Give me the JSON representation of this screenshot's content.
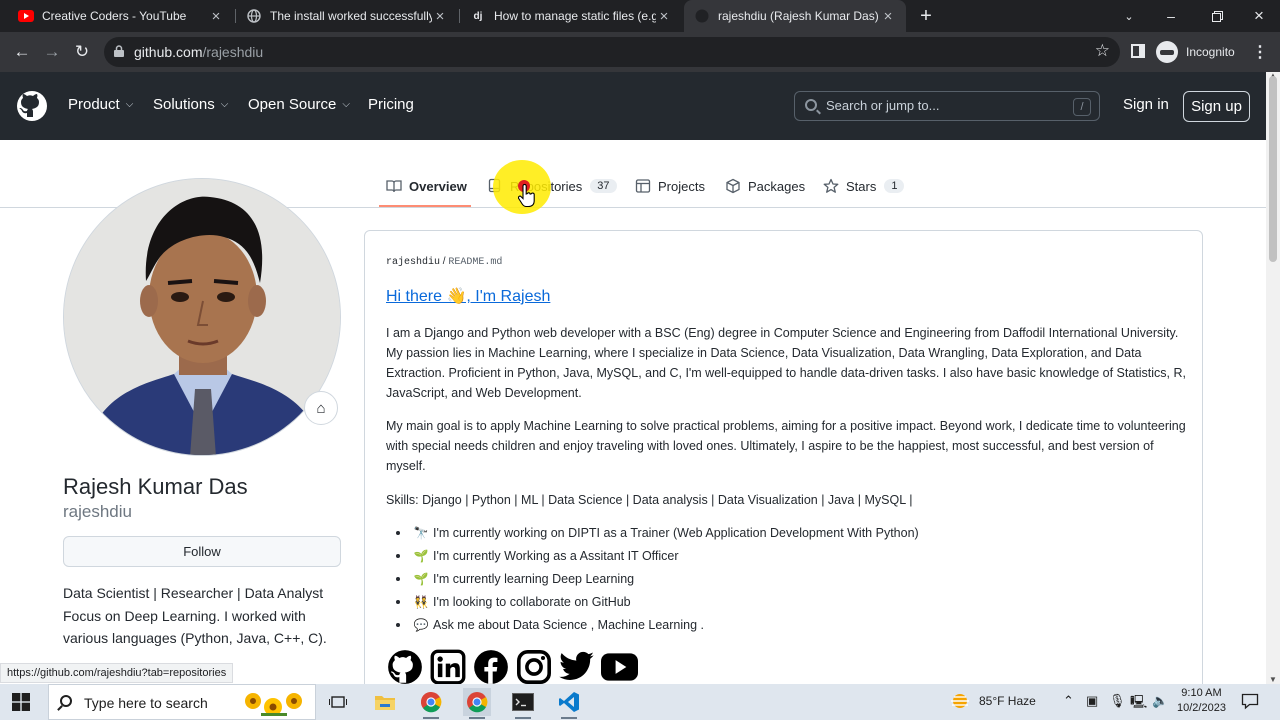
{
  "browser": {
    "tabs": [
      {
        "title": "Creative Coders - YouTube",
        "favicon": "youtube-icon"
      },
      {
        "title": "The install worked successfully! C",
        "favicon": "globe-icon"
      },
      {
        "title": "How to manage static files (e.g. i",
        "favicon": "django-icon",
        "favicon_text": "dj"
      },
      {
        "title": "rajeshdiu (Rajesh Kumar Das) · Gi",
        "favicon": "github-icon",
        "active": true
      }
    ],
    "url_host": "github.com",
    "url_path": "/rajeshdiu",
    "incognito_label": "Incognito",
    "link_preview": "https://github.com/rajeshdiu?tab=repositories"
  },
  "github_header": {
    "nav": [
      "Product",
      "Solutions",
      "Open Source",
      "Pricing"
    ],
    "search_placeholder": "Search or jump to...",
    "search_shortcut": "/",
    "sign_in": "Sign in",
    "sign_up": "Sign up"
  },
  "profile_tabs": [
    {
      "label": "Overview",
      "icon": "book-icon",
      "selected": true
    },
    {
      "label": "Repositories",
      "icon": "repo-icon",
      "count": "37"
    },
    {
      "label": "Projects",
      "icon": "table-icon"
    },
    {
      "label": "Packages",
      "icon": "package-icon"
    },
    {
      "label": "Stars",
      "icon": "star-icon",
      "count": "1"
    }
  ],
  "profile": {
    "name": "Rajesh Kumar Das",
    "login": "rajeshdiu",
    "follow_label": "Follow",
    "status_emoji": "⌂",
    "bio_lines": [
      "Data Scientist | Researcher | Data Analyst",
      "Focus on Deep Learning. I worked with",
      "various languages (Python, Java, C++, C)."
    ]
  },
  "readme": {
    "owner": "rajeshdiu",
    "sep": " / ",
    "file": "README.md",
    "title": "Hi there 👋, I'm Rajesh",
    "paragraph1": "I am a Django and Python web developer with a BSC (Eng) degree in Computer Science and Engineering from Daffodil International University. My passion lies in Machine Learning, where I specialize in Data Science, Data Visualization, Data Wrangling, Data Exploration, and Data Extraction. Proficient in Python, Java, MySQL, and C, I'm well-equipped to handle data-driven tasks. I also have basic knowledge of Statistics, R, JavaScript, and Web Development.",
    "paragraph2": "My main goal is to apply Machine Learning to solve practical problems, aiming for a positive impact. Beyond work, I dedicate time to volunteering with special needs children and enjoy traveling with loved ones. Ultimately, I aspire to be the happiest, most successful, and best version of myself.",
    "skills": "Skills: Django | Python | ML | Data Science | Data analysis | Data Visualization | Java | MySQL |",
    "bullets": [
      {
        "emoji": "🔭",
        "text": "I'm currently working on DIPTI as a Trainer (Web Application Development With Python)"
      },
      {
        "emoji": "🌱",
        "text": "I'm currently Working as a Assitant IT Officer"
      },
      {
        "emoji": "🌱",
        "text": "I'm currently learning Deep Learning"
      },
      {
        "emoji": "👯",
        "text": "I'm looking to collaborate on GitHub"
      },
      {
        "emoji": "💬",
        "text": "Ask me about Data Science , Machine Learning ."
      }
    ],
    "social_icons": [
      "github-icon",
      "linkedin-icon",
      "facebook-icon",
      "instagram-icon",
      "twitter-icon",
      "youtube-icon"
    ]
  },
  "taskbar": {
    "search_placeholder": "Type here to search",
    "weather": "85°F  Haze",
    "time": "9:10 AM",
    "date": "10/2/2023"
  }
}
